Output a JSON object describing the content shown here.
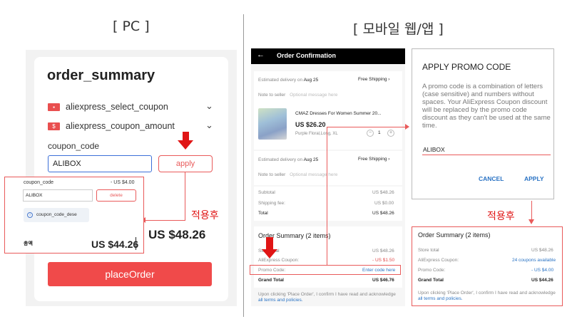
{
  "headings": {
    "pc": "[ PC ]",
    "mobile": "[ 모바일 웹/앱 ]"
  },
  "pc": {
    "title": "order_summary",
    "coupons": [
      {
        "badge": "▪",
        "label": "aliexpress_select_coupon"
      },
      {
        "badge": "$",
        "label": "aliexpress_coupon_amount"
      }
    ],
    "coupon_code_label": "coupon_code",
    "coupon_code_value": "ALIBOX",
    "apply_label": "apply",
    "popup": {
      "label": "coupon_code",
      "discount": "- US $4.00",
      "input_value": "ALIBOX",
      "button_label": "delete",
      "info_text": "coupon_code_dese",
      "total_label": "총액",
      "total_value": "US $44.26"
    },
    "big_total": "US $48.26",
    "place_order": "placeOrder",
    "annotation": "적용후"
  },
  "mobile": {
    "header_title": "Order Confirmation",
    "back_icon": "arrow-left-icon",
    "item1": {
      "delivery": "Estimated delivery on",
      "delivery_date": "Aug 25",
      "shipping": "Free Shipping",
      "note_label": "Note to seller",
      "note_placeholder": "Optional message here",
      "product_name": "CMAZ Dresses For Women Summer 20...",
      "price": "US $26.20",
      "variant": "Purple Floral,Long, XL",
      "qty": "1"
    },
    "item2": {
      "delivery": "Estimated delivery on",
      "delivery_date": "Aug 25",
      "shipping": "Free Shipping",
      "note_label": "Note to seller",
      "note_placeholder": "Optional message here"
    },
    "totals": [
      {
        "label": "Subtotal",
        "value": "US $48.26"
      },
      {
        "label": "Shipping fee:",
        "value": "US $0.00"
      },
      {
        "label": "Total",
        "value": "US $48.26"
      }
    ],
    "summary": {
      "title": "Order Summary (2 items)",
      "rows": [
        {
          "label": "Store total",
          "value": "US $48.26"
        },
        {
          "label": "AliExpress Coupon:",
          "value": "- US $1.50"
        },
        {
          "label": "Promo Code:",
          "value": "Enter code here"
        },
        {
          "label": "Grand Total",
          "value": "US $46.76"
        }
      ],
      "footer": "Upon clicking 'Place Order', I confirm I have read and acknowledge",
      "footer_link": "all terms and policies."
    }
  },
  "dialog": {
    "title": "APPLY PROMO CODE",
    "text": "A promo code is a combination of letters (case sensitive) and numbers without spaces. Your AliExpress Coupon discount will be replaced by the promo code discount as they can't be used at the same time.",
    "value": "ALIBOX",
    "cancel": "CANCEL",
    "apply": "APPLY"
  },
  "result": {
    "annotation": "적용후",
    "title": "Order Summary (2 items)",
    "rows": [
      {
        "label": "Store total",
        "value": "US $48.26"
      },
      {
        "label": "AliExpress Coupon:",
        "value": "24 coupons available"
      },
      {
        "label": "Promo Code:",
        "value": "- US $4.00"
      },
      {
        "label": "Grand Total",
        "value": "US $44.26"
      }
    ],
    "footer": "Upon clicking 'Place Order', I confirm I have read and acknowledge",
    "footer_link": "all terms and policies."
  },
  "colors": {
    "accent_red": "#f04a4a",
    "arrow_red": "#e01515",
    "link_blue": "#2a73c4"
  }
}
